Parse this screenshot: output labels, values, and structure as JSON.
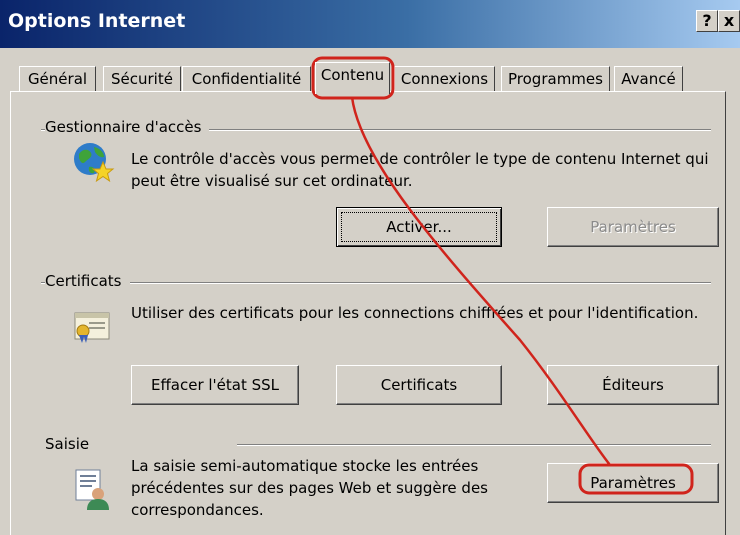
{
  "window": {
    "title": "Options Internet",
    "help_glyph": "?",
    "close_glyph": "x"
  },
  "tabs": [
    {
      "label": "Général"
    },
    {
      "label": "Sécurité"
    },
    {
      "label": "Confidentialité"
    },
    {
      "label": "Contenu",
      "active": true
    },
    {
      "label": "Connexions"
    },
    {
      "label": "Programmes"
    },
    {
      "label": "Avancé"
    }
  ],
  "access_manager": {
    "title": "Gestionnaire d'accès",
    "icon": "globe-star-icon",
    "description": "Le contrôle d'accès vous permet de contrôler le type de contenu Internet qui peut être visualisé sur cet ordinateur.",
    "enable_button": "Activer...",
    "settings_button": "Paramètres"
  },
  "certificates": {
    "title": "Certificats",
    "icon": "certificate-icon",
    "description": "Utiliser des certificats pour les connections chiffrées et pour l'identification.",
    "clear_ssl_button": "Effacer l'état SSL",
    "certificates_button": "Certificats",
    "publishers_button": "Éditeurs"
  },
  "autocomplete": {
    "title": "Saisie",
    "icon": "form-user-icon",
    "description": "La saisie semi-automatique stocke les entrées précédentes sur des pages Web et suggère des correspondances.",
    "settings_button": "Paramètres"
  },
  "annotation_color": "#d0241c"
}
